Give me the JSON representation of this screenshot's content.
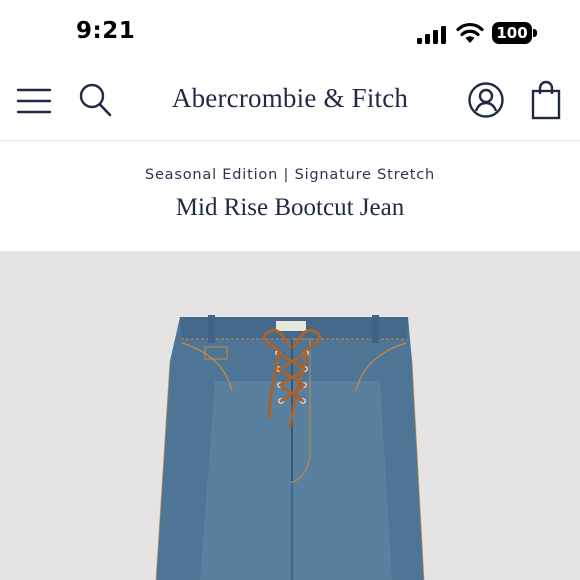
{
  "status_bar": {
    "time": "9:21",
    "battery": "100",
    "icons": [
      "signal-icon",
      "wifi-icon",
      "battery-icon"
    ]
  },
  "nav": {
    "brand": "Abercrombie & Fitch",
    "icons": [
      "menu-icon",
      "search-icon",
      "account-icon",
      "shopping-bag-icon"
    ]
  },
  "product": {
    "collection": "Seasonal Edition | Signature Stretch",
    "name": "Mid Rise Bootcut Jean"
  },
  "colors": {
    "brand_navy": "#1f2a44",
    "image_background": "#e6e3e5",
    "denim": "#4e7596",
    "lace": "#a8632c"
  }
}
